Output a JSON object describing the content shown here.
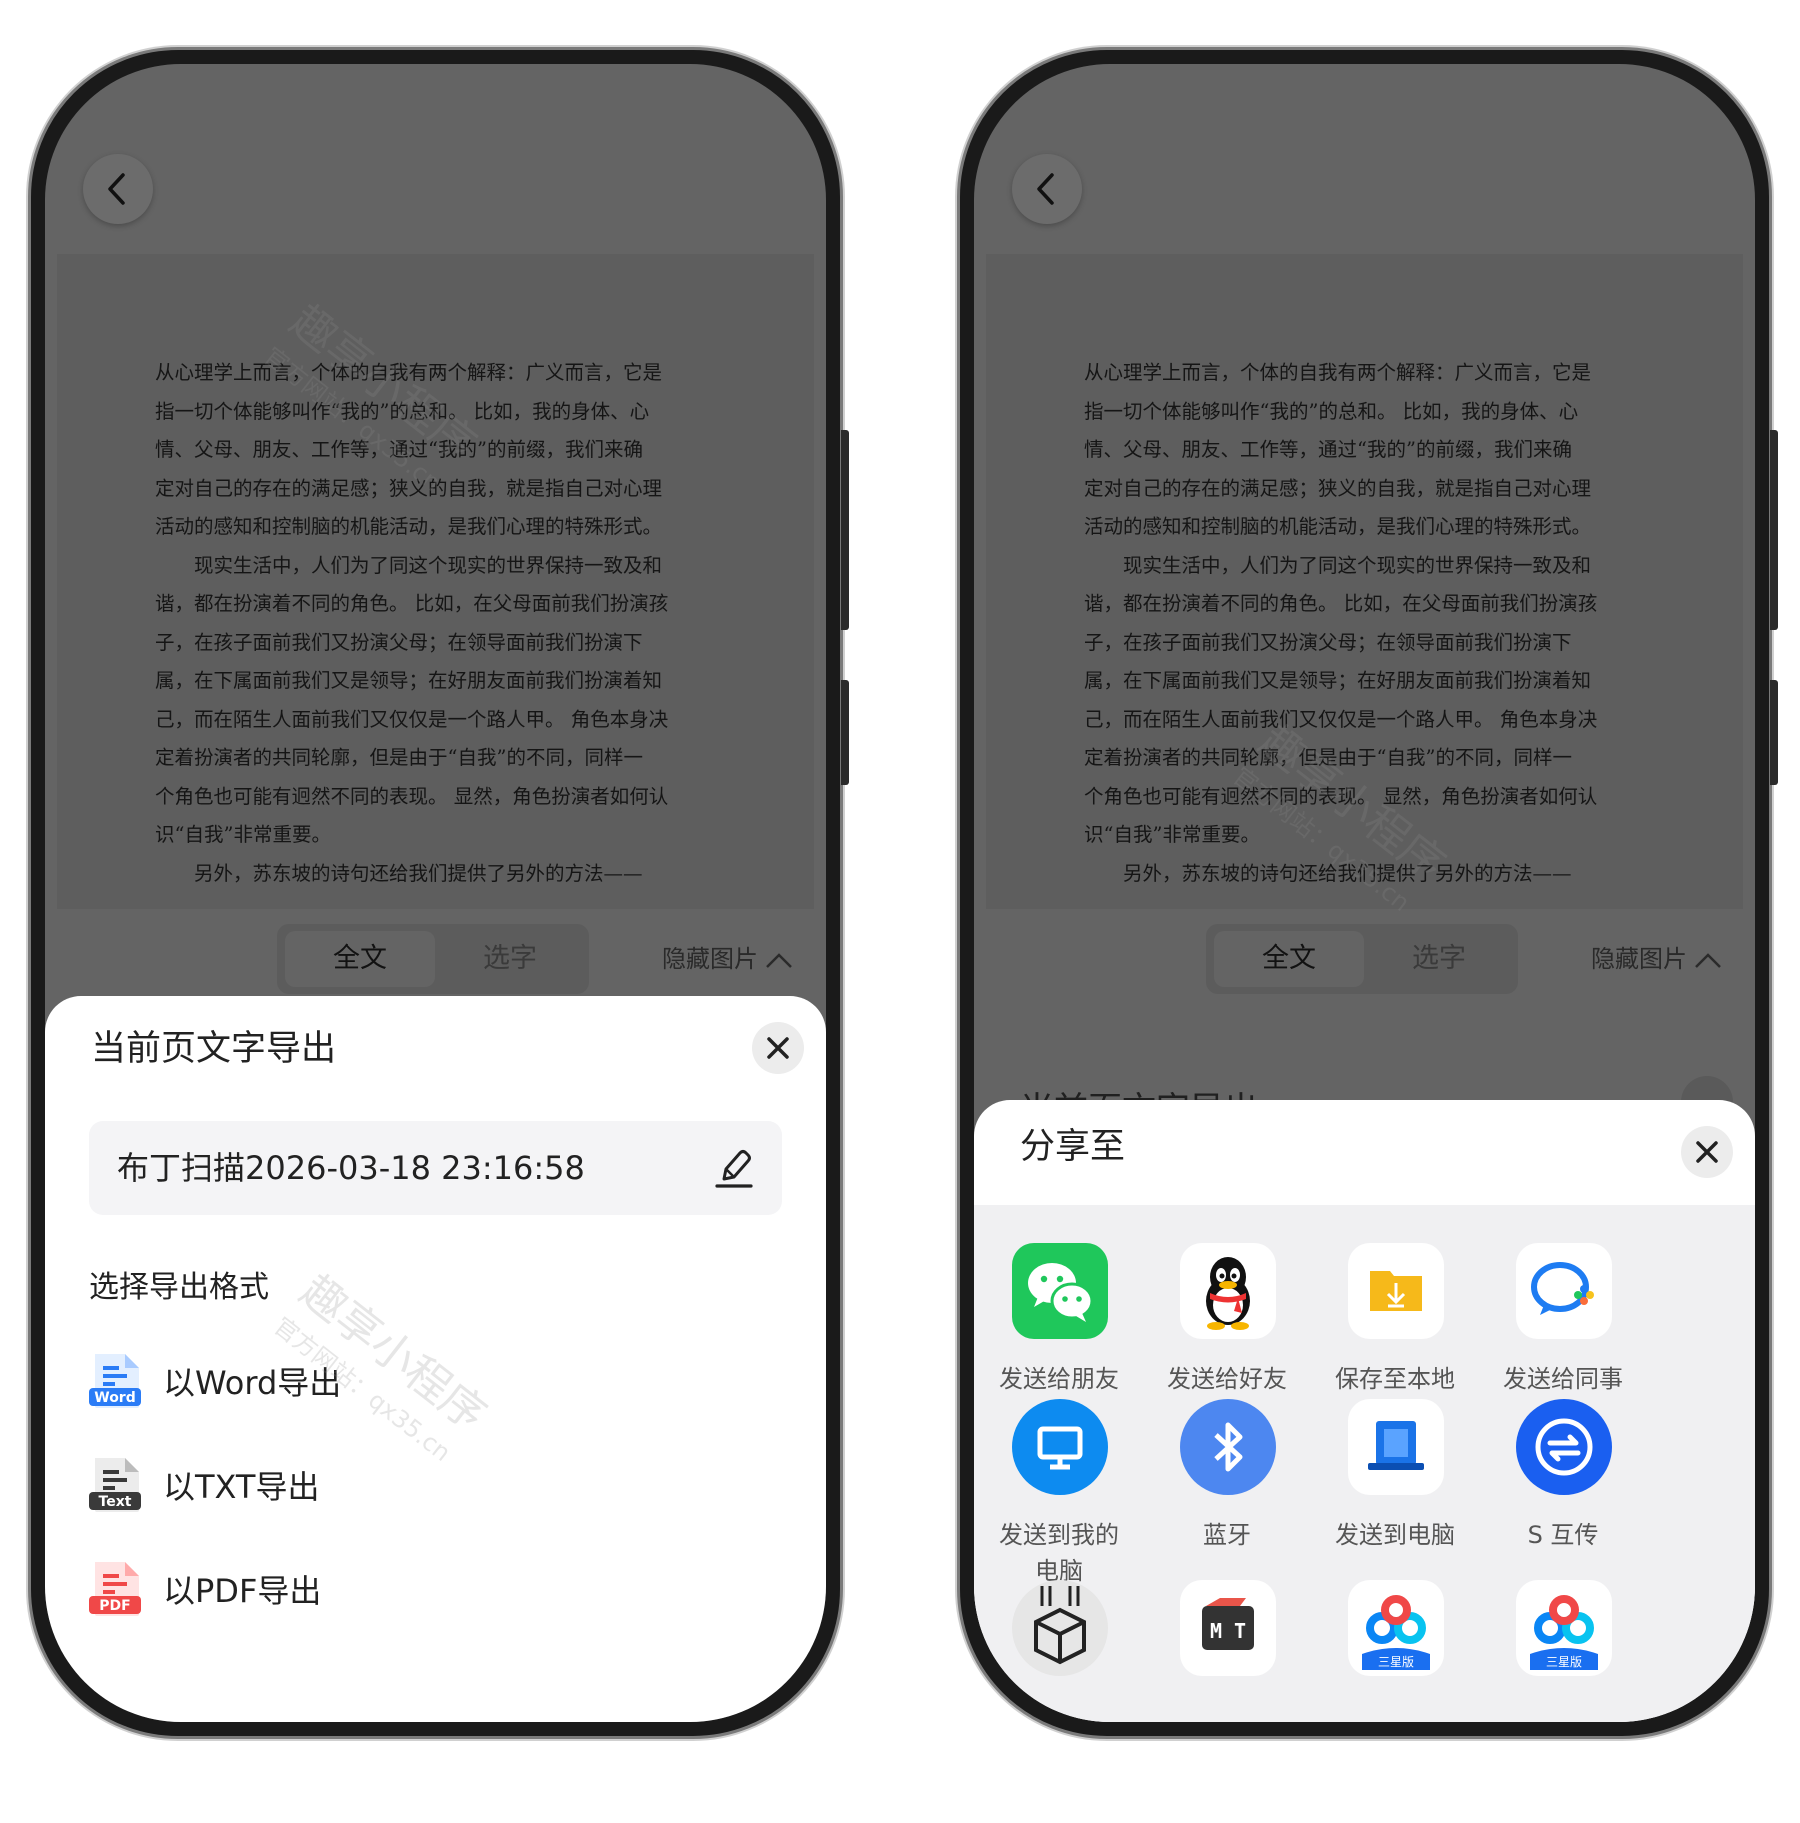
{
  "page_text": {
    "lines1": [
      "从心理学上而言，个体的自我有两个解释：广义而言，它是",
      "指一切个体能够叫作“我的”的总和。 比如，我的身体、心",
      "情、父母、朋友、工作等，通过“我的”的前缀，我们来确",
      "定对自己的存在的满足感；狭义的自我，就是指自己对心理",
      "活动的感知和控制脑的机能活动，是我们心理的特殊形式。"
    ],
    "lines2": [
      "现实生活中，人们为了同这个现实的世界保持一致及和",
      "谐，都在扮演着不同的角色。 比如，在父母面前我们扮演孩",
      "子，在孩子面前我们又扮演父母；在领导面前我们扮演下",
      "属，在下属面前我们又是领导；在好朋友面前我们扮演着知",
      "己，而在陌生人面前我们又仅仅是一个路人甲。 角色本身决",
      "定着扮演者的共同轮廓，但是由于“自我”的不同，同样一",
      "个角色也可能有迥然不同的表现。 显然，角色扮演者如何认",
      "识“自我”非常重要。"
    ],
    "lines3": [
      "另外，苏东坡的诗句还给我们提供了另外的方法——"
    ]
  },
  "mode_tabs": {
    "full": "全文",
    "select": "选字"
  },
  "hide_images": "隐藏图片",
  "export_sheet": {
    "title": "当前页文字导出",
    "filename": "布丁扫描2026-03-18 23:16:58",
    "format_title": "选择导出格式",
    "formats": [
      {
        "label": "以Word导出",
        "badge": "Word",
        "color": "#2b7cf6"
      },
      {
        "label": "以TXT导出",
        "badge": "Text",
        "color": "#3a3a3a"
      },
      {
        "label": "以PDF导出",
        "badge": "PDF",
        "color": "#f04848"
      }
    ]
  },
  "share_sheet": {
    "title": "分享至",
    "apps": [
      {
        "label": "发送给朋友",
        "icon": "wechat-icon"
      },
      {
        "label": "发送给好友",
        "icon": "qq-penguin-icon"
      },
      {
        "label": "保存至本地",
        "icon": "folder-download-icon"
      },
      {
        "label": "发送给同事",
        "icon": "wecom-icon"
      },
      {
        "label": "发送到我的\n电脑",
        "icon": "monitor-icon"
      },
      {
        "label": "蓝牙",
        "icon": "bluetooth-icon"
      },
      {
        "label": "发送到电脑",
        "icon": "laptop-icon"
      },
      {
        "label": "S 互传",
        "icon": "transfer-icon"
      },
      {
        "label": "",
        "icon": "package-icon"
      },
      {
        "label": "",
        "icon": "mt-manager-icon"
      },
      {
        "label": "",
        "icon": "baidu-cloud-icon",
        "badge": "三星版"
      },
      {
        "label": "",
        "icon": "baidu-cloud-icon",
        "badge": "三星版"
      }
    ]
  },
  "watermark": {
    "main": "趣享小程序",
    "sub": "官方网站：qx35.cn"
  }
}
